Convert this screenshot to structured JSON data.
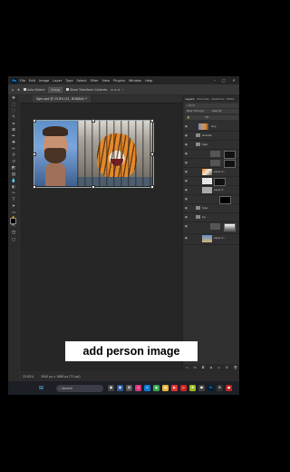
{
  "app": {
    "menus": [
      "File",
      "Edit",
      "Image",
      "Layer",
      "Type",
      "Select",
      "Filter",
      "View",
      "Plugins",
      "Window",
      "Help"
    ],
    "logo_text": "Ps"
  },
  "options_bar": {
    "auto_select_label": "Auto-Select:",
    "group_value": "Group",
    "show_transform_label": "Show Transform Controls"
  },
  "document": {
    "tab_title": "Sgm.psd @ 25.8% (S1, RGB/8#) *",
    "zoom": "25.82%",
    "size": "3000 px x 1688 px (72 ppi)"
  },
  "caption": "add person image",
  "panel": {
    "tabs": [
      "Layers",
      "Channels",
      "Swatches",
      "Paths"
    ],
    "kind_label": "Kind",
    "blend_mode": "Pass Through",
    "opacity_label": "Opacity:",
    "fill_label": "Fill:",
    "layers": [
      {
        "name": "Guy",
        "type": "photo"
      },
      {
        "name": "shadow",
        "type": "folder"
      },
      {
        "name": "tiger",
        "type": "folder"
      },
      {
        "name": "",
        "type": "adjust-mask"
      },
      {
        "name": "",
        "type": "adjust-mask"
      },
      {
        "name": "Layer 2...",
        "type": "photo-mask"
      },
      {
        "name": "",
        "type": "mask"
      },
      {
        "name": "Layer 4",
        "type": "photo-mask"
      },
      {
        "name": "type",
        "type": "folder"
      },
      {
        "name": "bg",
        "type": "folder"
      },
      {
        "name": "",
        "type": "adjust-mask"
      },
      {
        "name": "Layer 1...",
        "type": "photo"
      }
    ]
  },
  "taskbar": {
    "search_placeholder": "Search"
  }
}
